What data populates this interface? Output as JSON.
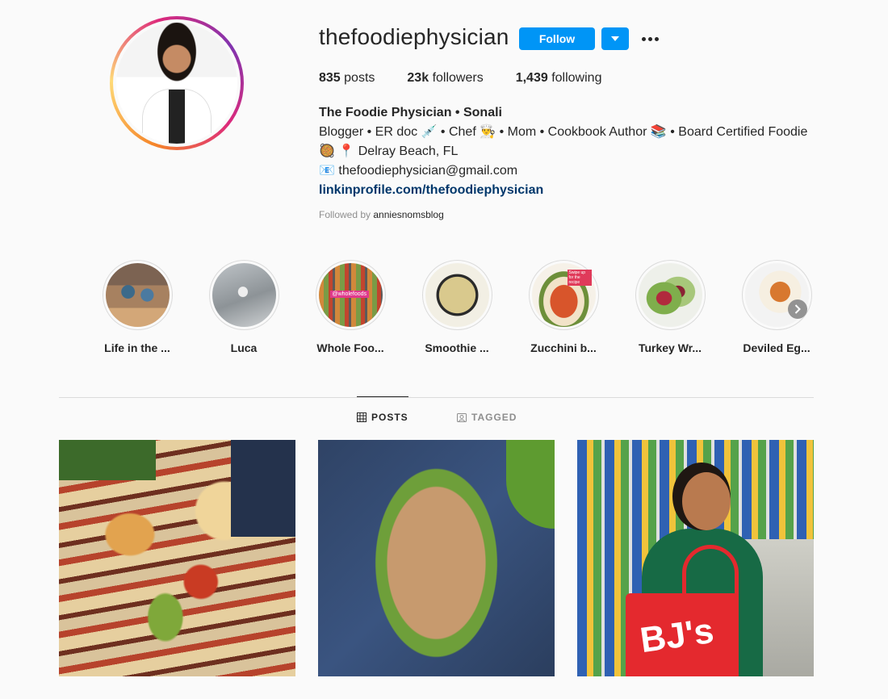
{
  "profile": {
    "username": "thefoodiephysician",
    "follow_label": "Follow",
    "stats": {
      "posts_count": "835",
      "posts_label": "posts",
      "followers_count": "23k",
      "followers_label": "followers",
      "following_count": "1,439",
      "following_label": "following"
    },
    "bio": {
      "full_name": "The Foodie Physician • Sonali",
      "line1": "Blogger • ER doc 💉 • Chef 👨‍🍳 • Mom • Cookbook Author 📚 • Board Certified Foodie",
      "line2": "🥘 📍 Delray Beach, FL",
      "line3": "📧 thefoodiephysician@gmail.com",
      "link": "linkinprofile.com/thefoodiephysician"
    },
    "followed_by_prefix": "Followed by",
    "followed_by_user": "anniesnomsblog"
  },
  "highlights": [
    {
      "label": "Life in the ..."
    },
    {
      "label": "Luca"
    },
    {
      "label": "Whole Foo..."
    },
    {
      "label": "Smoothie ..."
    },
    {
      "label": "Zucchini b..."
    },
    {
      "label": "Turkey Wr..."
    },
    {
      "label": "Deviled Eg..."
    }
  ],
  "highlight_images": {
    "images_text": {
      "whole_foods_tag": "@wholefoods",
      "zucchini_tag": "Swipe up for the recipe"
    }
  },
  "tabs": {
    "posts": "POSTS",
    "tagged": "TAGGED"
  },
  "posts": {
    "post3_bag_text": "BJ's"
  },
  "colors": {
    "accent": "#0095f6",
    "link": "#00376b",
    "muted": "#8e8e8e",
    "border": "#dbdbdb",
    "background": "#fafafa"
  },
  "icons": {
    "dropdown": "chevron-down-icon",
    "more": "more-options-icon",
    "posts_tab": "grid-icon",
    "tagged_tab": "tagged-person-icon",
    "next_highlight": "chevron-right-icon"
  }
}
